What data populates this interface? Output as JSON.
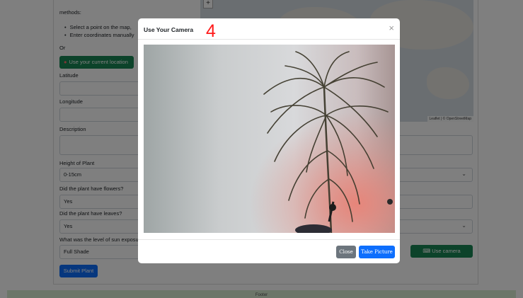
{
  "form": {
    "methods_label": "methods:",
    "method_items": [
      "Select a point on the map,",
      "Enter coordinates manually"
    ],
    "or_label": "Or",
    "use_location_label": "Use your current location",
    "latitude_label": "Latitude",
    "longitude_label": "Longitude",
    "description_label": "Description",
    "height_label": "Height of Plant",
    "height_value": "0-15cm",
    "flowers_label": "Did the plant have flowers?",
    "flowers_value": "Yes",
    "leaves_label": "Did the plant have leaves?",
    "leaves_value": "Yes",
    "sun_label": "What was the level of sun exposur",
    "sun_value": "Full Shade",
    "use_camera_label": "Use camera",
    "submit_label": "Submit Plant"
  },
  "map": {
    "zoom_in_label": "+",
    "attribution": "Leaflet | © OpenStreetMap"
  },
  "footer": {
    "text": "Footer"
  },
  "modal": {
    "title": "Use Your Camera",
    "annotation": "4",
    "close_icon": "×",
    "close_button": "Close",
    "take_picture_button": "Take Picture"
  },
  "colors": {
    "success": "#198754",
    "primary": "#0d6efd",
    "secondary": "#6c757d",
    "annotation": "#ff1a1a"
  }
}
